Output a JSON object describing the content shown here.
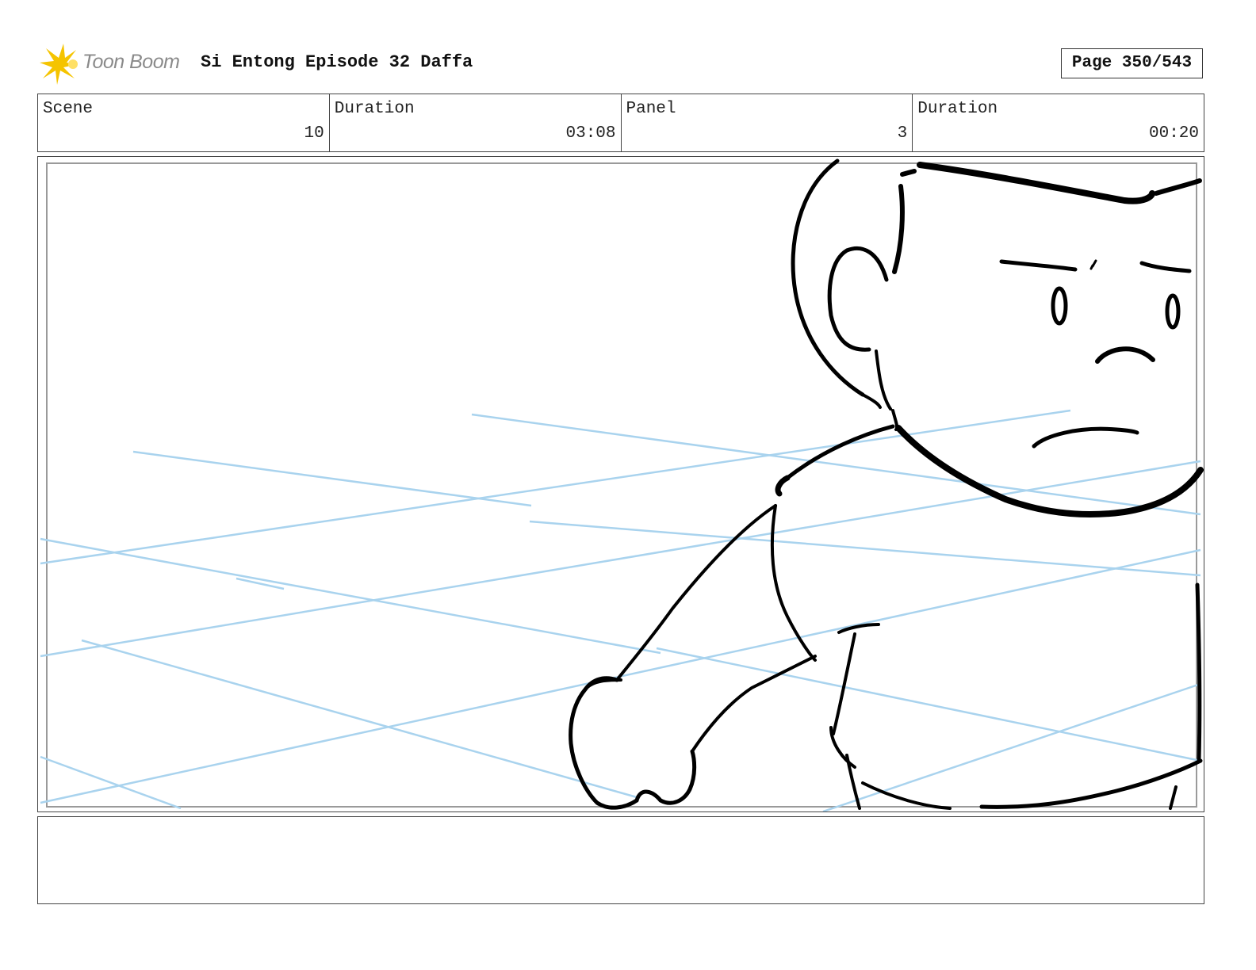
{
  "header": {
    "logo_text": "Toon Boom",
    "title": "Si Entong Episode 32 Daffa",
    "page_label": "Page 350/543"
  },
  "info": {
    "scene_label": "Scene",
    "scene_value": "10",
    "scene_duration_label": "Duration",
    "scene_duration_value": "03:08",
    "panel_label": "Panel",
    "panel_value": "3",
    "panel_duration_label": "Duration",
    "panel_duration_value": "00:20"
  },
  "colors": {
    "guide_lines": "#a9d3ee",
    "sketch": "#000000",
    "logo_burst": "#f5c400"
  }
}
